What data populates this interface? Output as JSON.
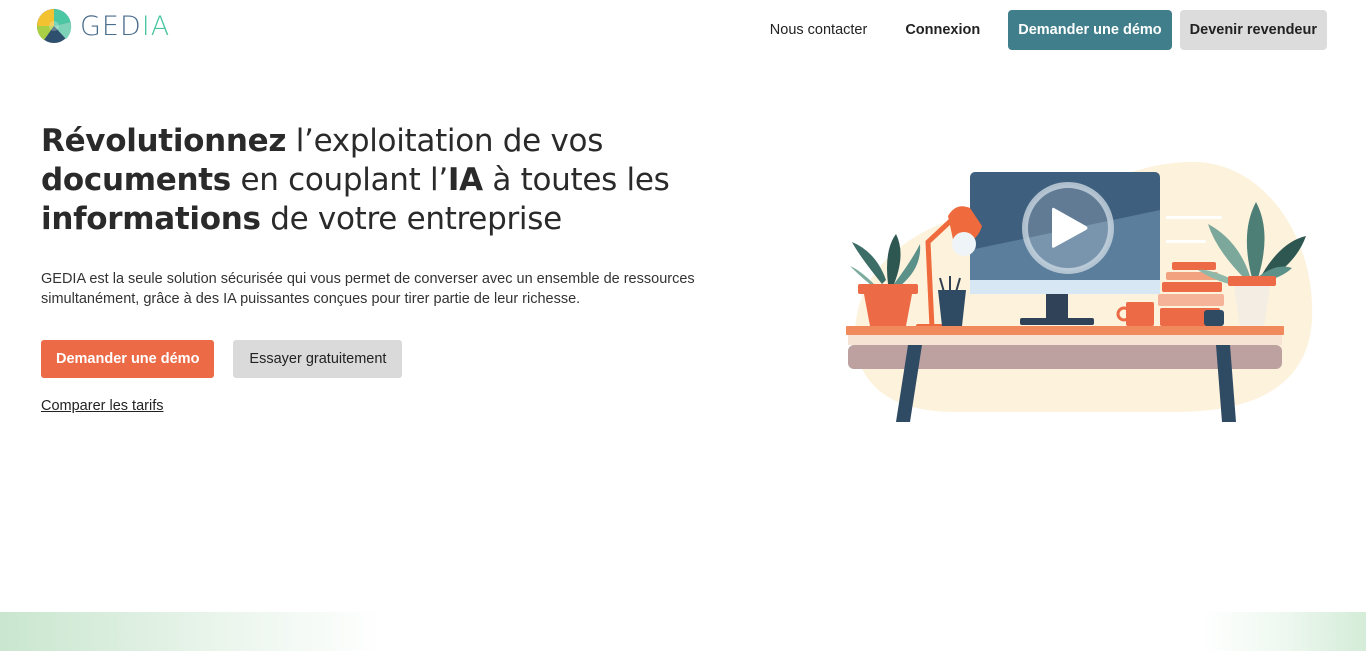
{
  "brand": {
    "name_part1": "GED",
    "name_part2": "IA",
    "colors": {
      "primary": "#3f7e8a",
      "accent": "#ec6a46",
      "logo_text": "#4a6d8c",
      "logo_ia": "#49c6a0"
    }
  },
  "nav": {
    "contact_label": "Nous contacter",
    "login_label": "Connexion",
    "demo_label": "Demander une démo",
    "reseller_label": "Devenir revendeur"
  },
  "hero": {
    "title": {
      "w1": "Révolutionnez",
      "t1": " l’exploitation de vos ",
      "w2": "documents",
      "t2": " en couplant l’",
      "w3": "IA",
      "t3": " à toutes les ",
      "w4": "informations",
      "t4": " de votre entreprise"
    },
    "description": "GEDIA est la seule solution sécurisée qui vous permet de converser avec un ensemble de ressources simultanément, grâce à des IA puissantes conçues pour tirer partie de leur richesse.",
    "cta_demo_label": "Demander une démo",
    "cta_try_label": "Essayer gratuitement",
    "compare_label": "Comparer les tarifs"
  },
  "illustration": {
    "icon": "play-icon"
  }
}
